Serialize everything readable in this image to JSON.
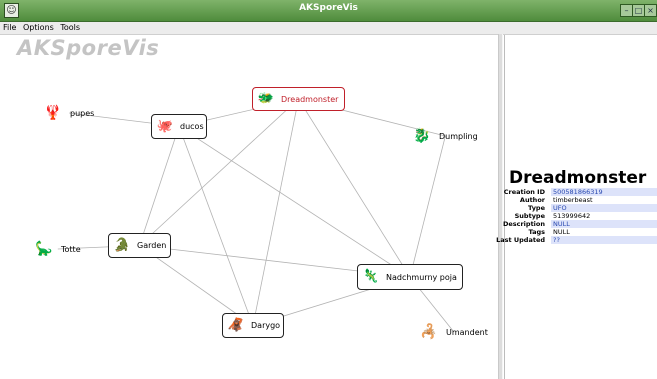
{
  "window": {
    "title": "AKSporeVis"
  },
  "menu": [
    "File",
    "Options",
    "Tools"
  ],
  "app": {
    "title": "AKSporeVis"
  },
  "graph": {
    "nodes": [
      {
        "id": "dreadmonster",
        "label": "Dreadmonster",
        "boxed": true,
        "selected": true,
        "icon": "creature-icon"
      },
      {
        "id": "ducos",
        "label": "ducos",
        "boxed": true,
        "icon": "creature-icon"
      },
      {
        "id": "garden",
        "label": "Garden",
        "boxed": true,
        "icon": "creature-icon"
      },
      {
        "id": "nadchmurny",
        "label": "Nadchmurny poja",
        "boxed": true,
        "icon": "creature-icon"
      },
      {
        "id": "darygo",
        "label": "Darygo",
        "boxed": true,
        "icon": "creature-icon"
      },
      {
        "id": "pupes",
        "label": "pupes",
        "boxed": false,
        "icon": "creature-icon"
      },
      {
        "id": "dumpling",
        "label": "Dumpling",
        "boxed": false,
        "icon": "creature-icon"
      },
      {
        "id": "totte",
        "label": "Totte",
        "boxed": false,
        "icon": "creature-icon"
      },
      {
        "id": "umandent",
        "label": "Umandent",
        "boxed": false,
        "icon": "creature-icon"
      }
    ],
    "edges": [
      [
        "pupes",
        "ducos"
      ],
      [
        "ducos",
        "dreadmonster"
      ],
      [
        "ducos",
        "garden"
      ],
      [
        "ducos",
        "darygo"
      ],
      [
        "ducos",
        "nadchmurny"
      ],
      [
        "dreadmonster",
        "dumpling"
      ],
      [
        "dreadmonster",
        "nadchmurny"
      ],
      [
        "dreadmonster",
        "darygo"
      ],
      [
        "dreadmonster",
        "garden"
      ],
      [
        "dumpling",
        "nadchmurny"
      ],
      [
        "totte",
        "garden"
      ],
      [
        "garden",
        "darygo"
      ],
      [
        "garden",
        "nadchmurny"
      ],
      [
        "nadchmurny",
        "darygo"
      ],
      [
        "nadchmurny",
        "umandent"
      ]
    ]
  },
  "details": {
    "name": "Dreadmonster",
    "rows": [
      {
        "key": "Creation ID",
        "value": "500581866319"
      },
      {
        "key": "Author",
        "value": "timberbeast"
      },
      {
        "key": "Type",
        "value": "UFO"
      },
      {
        "key": "Subtype",
        "value": "513999642"
      },
      {
        "key": "Description",
        "value": "NULL"
      },
      {
        "key": "Tags",
        "value": "NULL"
      },
      {
        "key": "Last Updated",
        "value": "??"
      }
    ]
  }
}
